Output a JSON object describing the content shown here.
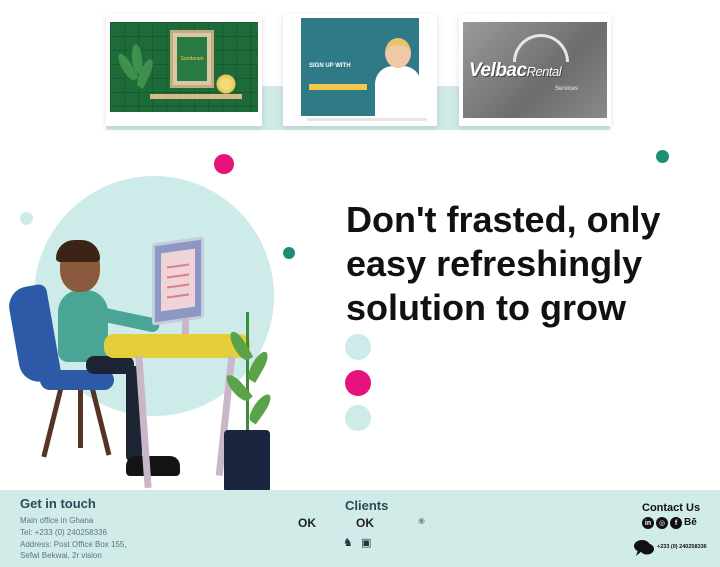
{
  "portfolio": {
    "card1_caption": "Sundaram",
    "card2_title": "SIGN UP WITH",
    "card3_brand": "Velbac",
    "card3_brand_suffix": "Rental",
    "card3_tagline": "Services"
  },
  "hero": {
    "headline_lines": [
      "Don't frasted, only",
      "easy refreshingly",
      "solution to grow"
    ]
  },
  "colors": {
    "accent_pink": "#e8127c",
    "accent_teal": "#1f8c75",
    "mint": "#cdebe8",
    "footer_bg": "#d0ebe8",
    "text_dark": "#111111"
  },
  "footer": {
    "get_in_touch": {
      "title": "Get in touch",
      "lines": [
        "Main office in Ghana",
        "Tel: +233 (0) 240258336",
        "Address: Post Office Box 155,",
        "Sefwi Bekwai, 2r vision"
      ]
    },
    "clients": {
      "title": "Clients",
      "logos": [
        "OK",
        "OK"
      ]
    },
    "contact": {
      "title": "Contact Us",
      "icons": [
        "linkedin-icon",
        "instagram-icon",
        "facebook-icon",
        "behance-icon"
      ],
      "behance_label": "Bē",
      "phone": "+233 (0) 240258336"
    }
  }
}
